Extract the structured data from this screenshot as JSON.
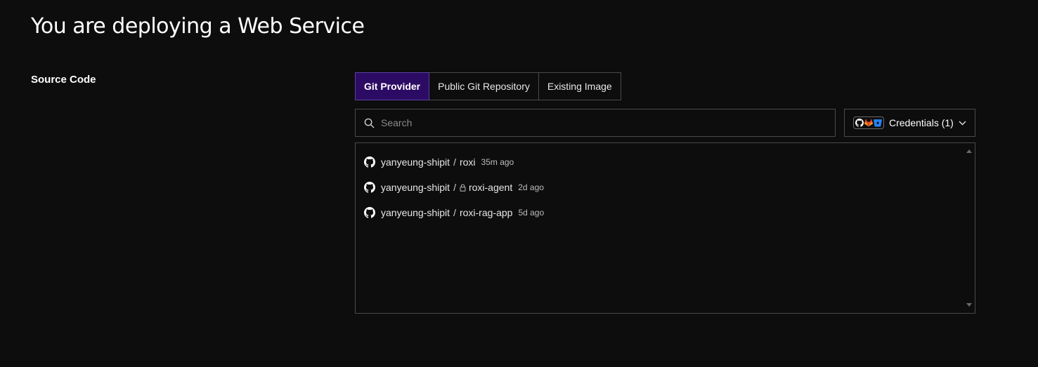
{
  "page": {
    "title": "You are deploying a Web Service"
  },
  "source_code": {
    "label": "Source Code",
    "tabs": [
      {
        "label": "Git Provider",
        "active": true
      },
      {
        "label": "Public Git Repository",
        "active": false
      },
      {
        "label": "Existing Image",
        "active": false
      }
    ],
    "search": {
      "placeholder": "Search",
      "value": "",
      "icon": "search-icon"
    },
    "credentials": {
      "label": "Credentials (1)",
      "icons": [
        "github-icon",
        "gitlab-icon",
        "bitbucket-icon"
      ],
      "chevron": "chevron-down-icon"
    },
    "repos": [
      {
        "owner": "yanyeung-shipit",
        "separator": "/",
        "name": "roxi",
        "private": false,
        "age": "35m ago"
      },
      {
        "owner": "yanyeung-shipit",
        "separator": "/",
        "name": "roxi-agent",
        "private": true,
        "age": "2d ago"
      },
      {
        "owner": "yanyeung-shipit",
        "separator": "/",
        "name": "roxi-rag-app",
        "private": false,
        "age": "5d ago"
      }
    ]
  },
  "colors": {
    "background": "#0d0d0d",
    "active_tab": "#2c0b64",
    "border": "#4a4a4a",
    "gitlab": "#e24329",
    "bitbucket": "#2684ff"
  }
}
